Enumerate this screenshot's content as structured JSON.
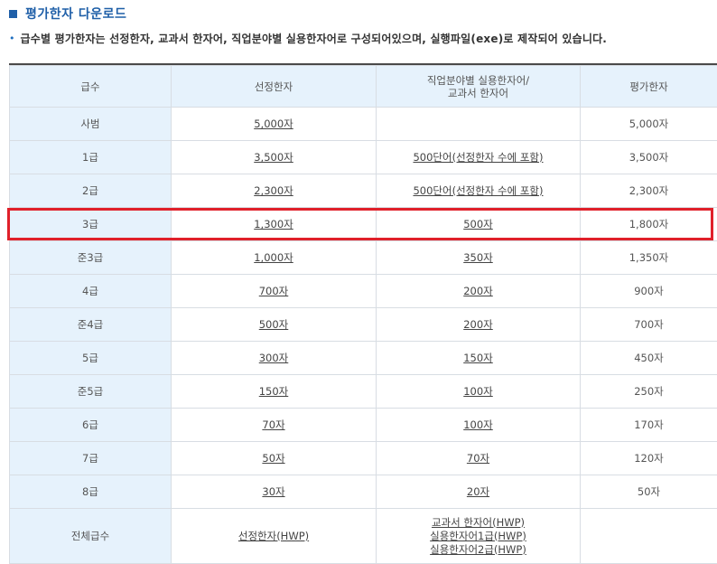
{
  "heading": {
    "title": "평가한자 다운로드"
  },
  "description": "급수별 평가한자는 선정한자, 교과서 한자어, 직업분야별 실용한자어로 구성되어있으며, 실행파일(exe)로 제작되어 있습니다.",
  "table": {
    "headers": {
      "grade": "급수",
      "selected": "선정한자",
      "vocational_line1": "직업분야별 실용한자어/",
      "vocational_line2": "교과서 한자어",
      "evaluation": "평가한자"
    },
    "rows": [
      {
        "grade": "사범",
        "selected": "5,000자",
        "vocational": "",
        "evaluation": "5,000자"
      },
      {
        "grade": "1급",
        "selected": "3,500자",
        "vocational": "500단어(선정한자 수에 포함)",
        "evaluation": "3,500자"
      },
      {
        "grade": "2급",
        "selected": "2,300자",
        "vocational": "500단어(선정한자 수에 포함)",
        "evaluation": "2,300자"
      },
      {
        "grade": "3급",
        "selected": "1,300자",
        "vocational": "500자",
        "evaluation": "1,800자"
      },
      {
        "grade": "준3급",
        "selected": "1,000자",
        "vocational": "350자",
        "evaluation": "1,350자"
      },
      {
        "grade": "4급",
        "selected": "700자",
        "vocational": "200자",
        "evaluation": "900자"
      },
      {
        "grade": "준4급",
        "selected": "500자",
        "vocational": "200자",
        "evaluation": "700자"
      },
      {
        "grade": "5급",
        "selected": "300자",
        "vocational": "150자",
        "evaluation": "450자"
      },
      {
        "grade": "준5급",
        "selected": "150자",
        "vocational": "100자",
        "evaluation": "250자"
      },
      {
        "grade": "6급",
        "selected": "70자",
        "vocational": "100자",
        "evaluation": "170자"
      },
      {
        "grade": "7급",
        "selected": "50자",
        "vocational": "70자",
        "evaluation": "120자"
      },
      {
        "grade": "8급",
        "selected": "30자",
        "vocational": "20자",
        "evaluation": "50자"
      }
    ],
    "total_row": {
      "grade": "전체급수",
      "selected": "선정한자(HWP)",
      "vocational_links": [
        "교과서 한자어(HWP)",
        "실용한자어1급(HWP)",
        "실용한자어2급(HWP)"
      ],
      "evaluation": ""
    }
  },
  "colors": {
    "accent": "#1f5fa8",
    "header_bg": "#e6f2fc",
    "highlight": "#e0202a"
  },
  "icons": {
    "heading_marker": "square-icon",
    "description_bullet": "bullet-dot-icon"
  }
}
